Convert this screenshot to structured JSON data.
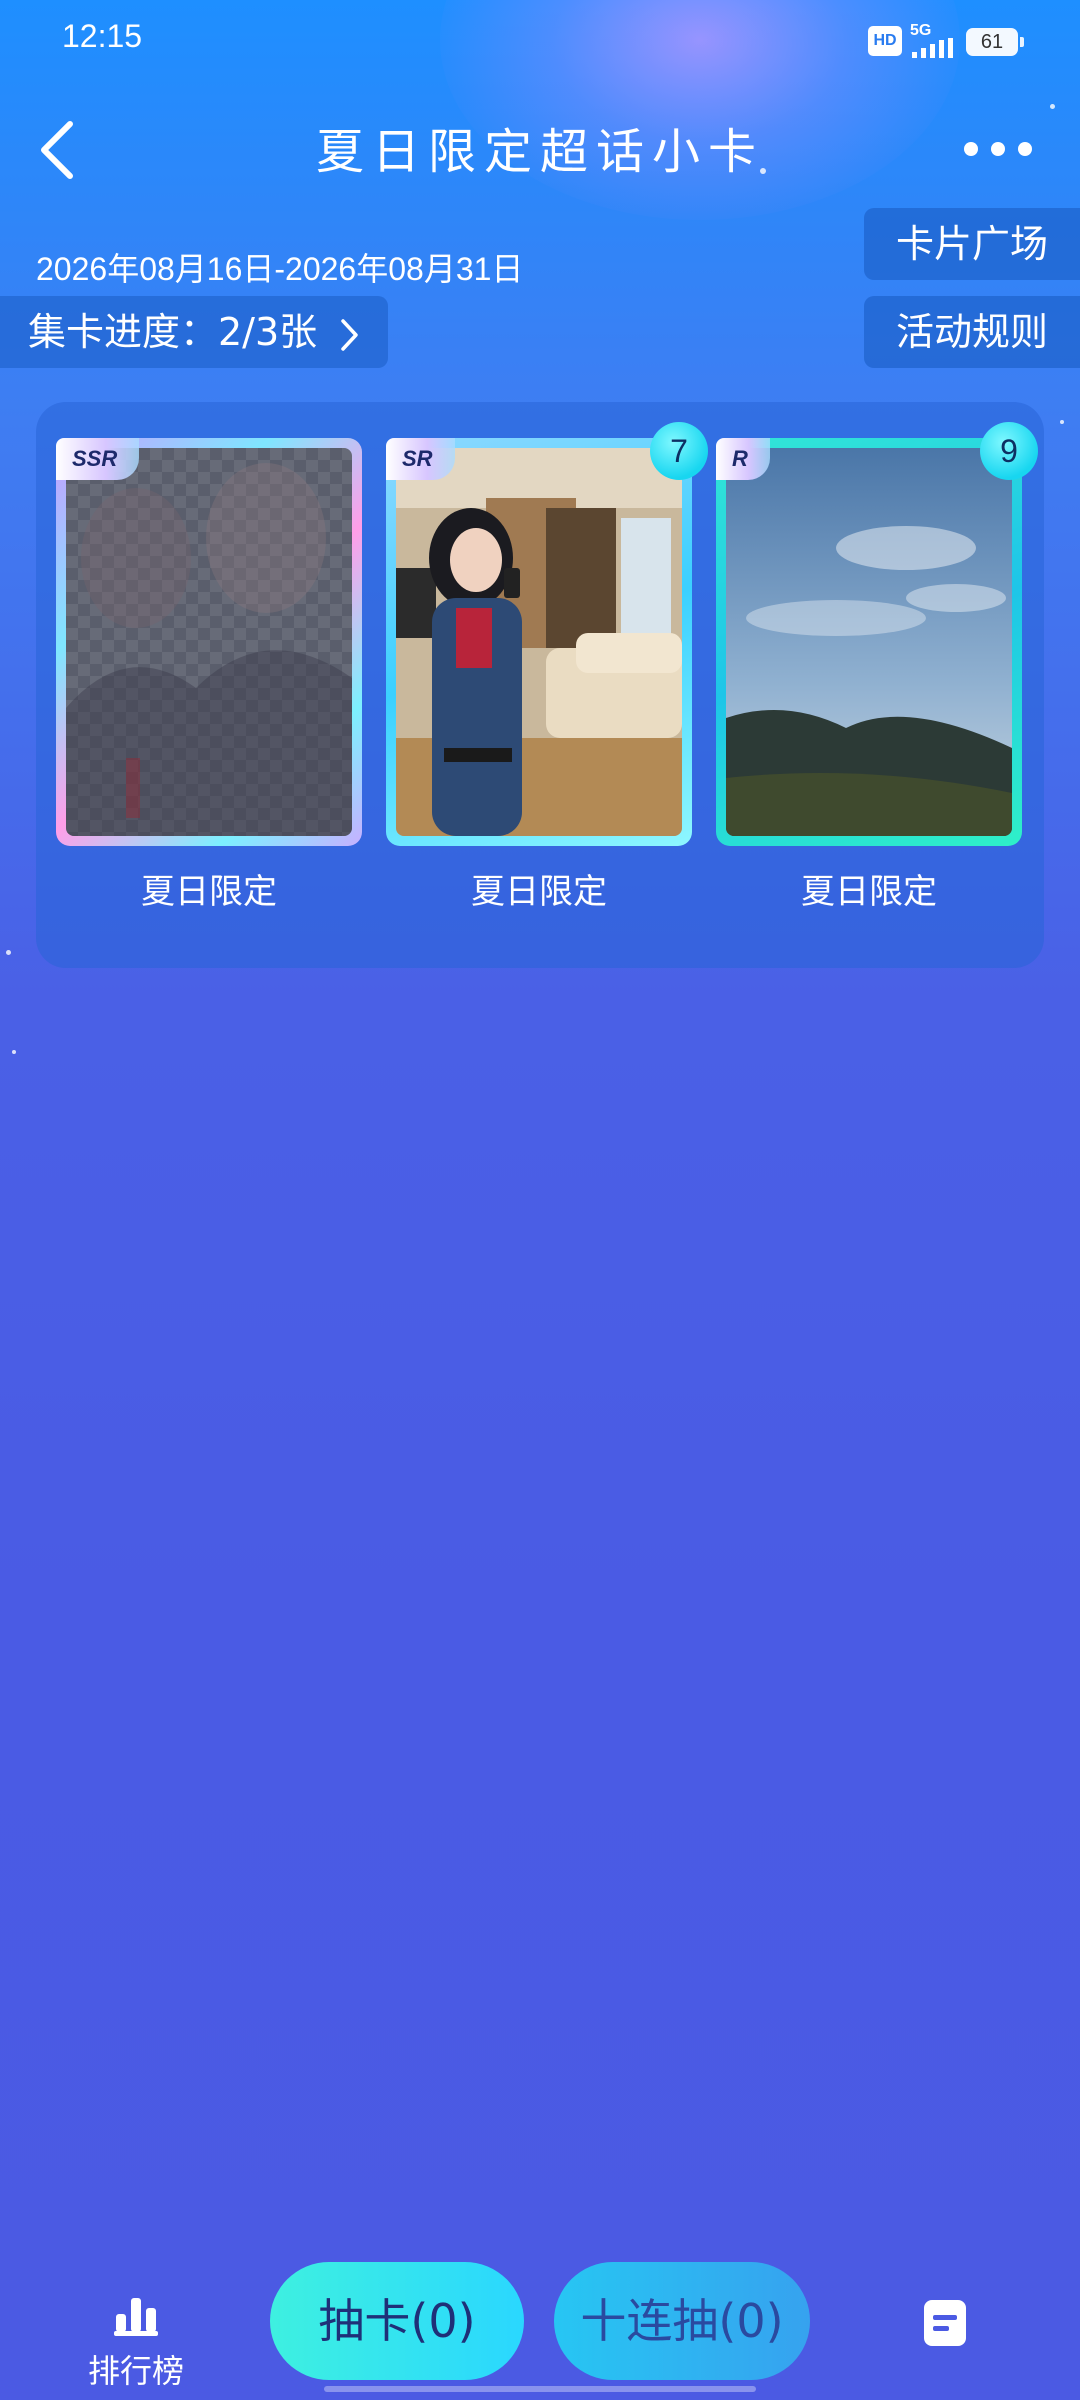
{
  "status_bar": {
    "time": "12:15",
    "hd_label": "HD",
    "network_label": "5G",
    "battery_level": "61"
  },
  "header": {
    "title": "夏日限定超话小卡",
    "back_icon": "chevron-left-icon",
    "more_icon": "more-horizontal-icon"
  },
  "activity": {
    "date_range": "2026年08月16日-2026年08月31日",
    "progress_label": "集卡进度：2/3张",
    "progress_value": 0.667
  },
  "side_buttons": {
    "card_square": "卡片广场",
    "rules": "活动规则"
  },
  "cards": [
    {
      "rarity": "SSR",
      "name": "夏日限定",
      "count": "",
      "collected": false
    },
    {
      "rarity": "SR",
      "name": "夏日限定",
      "count": "7",
      "collected": true
    },
    {
      "rarity": "R",
      "name": "夏日限定",
      "count": "9",
      "collected": true
    }
  ],
  "bottom_bar": {
    "leaderboard_label": "排行榜",
    "draw_label": "抽卡(0)",
    "ten_draw_label": "十连抽(0)",
    "leaderboard_icon": "bar-chart-icon",
    "records_icon": "document-icon"
  },
  "colors": {
    "background_top": "#1e8fff",
    "background_bottom": "#4b5ae3",
    "draw_button": "#3ef0e0",
    "ten_draw_button": "#27c6f3",
    "badge": "#18d6f0"
  }
}
